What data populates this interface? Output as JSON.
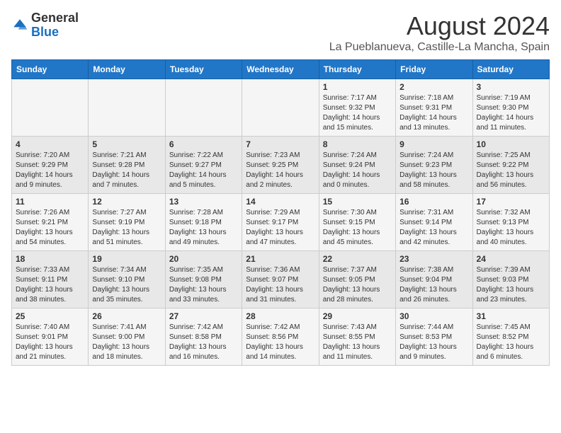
{
  "header": {
    "logo_general": "General",
    "logo_blue": "Blue",
    "month_year": "August 2024",
    "location": "La Pueblanueva, Castille-La Mancha, Spain"
  },
  "days_of_week": [
    "Sunday",
    "Monday",
    "Tuesday",
    "Wednesday",
    "Thursday",
    "Friday",
    "Saturday"
  ],
  "weeks": [
    [
      {
        "day": "",
        "info": ""
      },
      {
        "day": "",
        "info": ""
      },
      {
        "day": "",
        "info": ""
      },
      {
        "day": "",
        "info": ""
      },
      {
        "day": "1",
        "info": "Sunrise: 7:17 AM\nSunset: 9:32 PM\nDaylight: 14 hours and 15 minutes."
      },
      {
        "day": "2",
        "info": "Sunrise: 7:18 AM\nSunset: 9:31 PM\nDaylight: 14 hours and 13 minutes."
      },
      {
        "day": "3",
        "info": "Sunrise: 7:19 AM\nSunset: 9:30 PM\nDaylight: 14 hours and 11 minutes."
      }
    ],
    [
      {
        "day": "4",
        "info": "Sunrise: 7:20 AM\nSunset: 9:29 PM\nDaylight: 14 hours and 9 minutes."
      },
      {
        "day": "5",
        "info": "Sunrise: 7:21 AM\nSunset: 9:28 PM\nDaylight: 14 hours and 7 minutes."
      },
      {
        "day": "6",
        "info": "Sunrise: 7:22 AM\nSunset: 9:27 PM\nDaylight: 14 hours and 5 minutes."
      },
      {
        "day": "7",
        "info": "Sunrise: 7:23 AM\nSunset: 9:25 PM\nDaylight: 14 hours and 2 minutes."
      },
      {
        "day": "8",
        "info": "Sunrise: 7:24 AM\nSunset: 9:24 PM\nDaylight: 14 hours and 0 minutes."
      },
      {
        "day": "9",
        "info": "Sunrise: 7:24 AM\nSunset: 9:23 PM\nDaylight: 13 hours and 58 minutes."
      },
      {
        "day": "10",
        "info": "Sunrise: 7:25 AM\nSunset: 9:22 PM\nDaylight: 13 hours and 56 minutes."
      }
    ],
    [
      {
        "day": "11",
        "info": "Sunrise: 7:26 AM\nSunset: 9:21 PM\nDaylight: 13 hours and 54 minutes."
      },
      {
        "day": "12",
        "info": "Sunrise: 7:27 AM\nSunset: 9:19 PM\nDaylight: 13 hours and 51 minutes."
      },
      {
        "day": "13",
        "info": "Sunrise: 7:28 AM\nSunset: 9:18 PM\nDaylight: 13 hours and 49 minutes."
      },
      {
        "day": "14",
        "info": "Sunrise: 7:29 AM\nSunset: 9:17 PM\nDaylight: 13 hours and 47 minutes."
      },
      {
        "day": "15",
        "info": "Sunrise: 7:30 AM\nSunset: 9:15 PM\nDaylight: 13 hours and 45 minutes."
      },
      {
        "day": "16",
        "info": "Sunrise: 7:31 AM\nSunset: 9:14 PM\nDaylight: 13 hours and 42 minutes."
      },
      {
        "day": "17",
        "info": "Sunrise: 7:32 AM\nSunset: 9:13 PM\nDaylight: 13 hours and 40 minutes."
      }
    ],
    [
      {
        "day": "18",
        "info": "Sunrise: 7:33 AM\nSunset: 9:11 PM\nDaylight: 13 hours and 38 minutes."
      },
      {
        "day": "19",
        "info": "Sunrise: 7:34 AM\nSunset: 9:10 PM\nDaylight: 13 hours and 35 minutes."
      },
      {
        "day": "20",
        "info": "Sunrise: 7:35 AM\nSunset: 9:08 PM\nDaylight: 13 hours and 33 minutes."
      },
      {
        "day": "21",
        "info": "Sunrise: 7:36 AM\nSunset: 9:07 PM\nDaylight: 13 hours and 31 minutes."
      },
      {
        "day": "22",
        "info": "Sunrise: 7:37 AM\nSunset: 9:05 PM\nDaylight: 13 hours and 28 minutes."
      },
      {
        "day": "23",
        "info": "Sunrise: 7:38 AM\nSunset: 9:04 PM\nDaylight: 13 hours and 26 minutes."
      },
      {
        "day": "24",
        "info": "Sunrise: 7:39 AM\nSunset: 9:03 PM\nDaylight: 13 hours and 23 minutes."
      }
    ],
    [
      {
        "day": "25",
        "info": "Sunrise: 7:40 AM\nSunset: 9:01 PM\nDaylight: 13 hours and 21 minutes."
      },
      {
        "day": "26",
        "info": "Sunrise: 7:41 AM\nSunset: 9:00 PM\nDaylight: 13 hours and 18 minutes."
      },
      {
        "day": "27",
        "info": "Sunrise: 7:42 AM\nSunset: 8:58 PM\nDaylight: 13 hours and 16 minutes."
      },
      {
        "day": "28",
        "info": "Sunrise: 7:42 AM\nSunset: 8:56 PM\nDaylight: 13 hours and 14 minutes."
      },
      {
        "day": "29",
        "info": "Sunrise: 7:43 AM\nSunset: 8:55 PM\nDaylight: 13 hours and 11 minutes."
      },
      {
        "day": "30",
        "info": "Sunrise: 7:44 AM\nSunset: 8:53 PM\nDaylight: 13 hours and 9 minutes."
      },
      {
        "day": "31",
        "info": "Sunrise: 7:45 AM\nSunset: 8:52 PM\nDaylight: 13 hours and 6 minutes."
      }
    ]
  ]
}
